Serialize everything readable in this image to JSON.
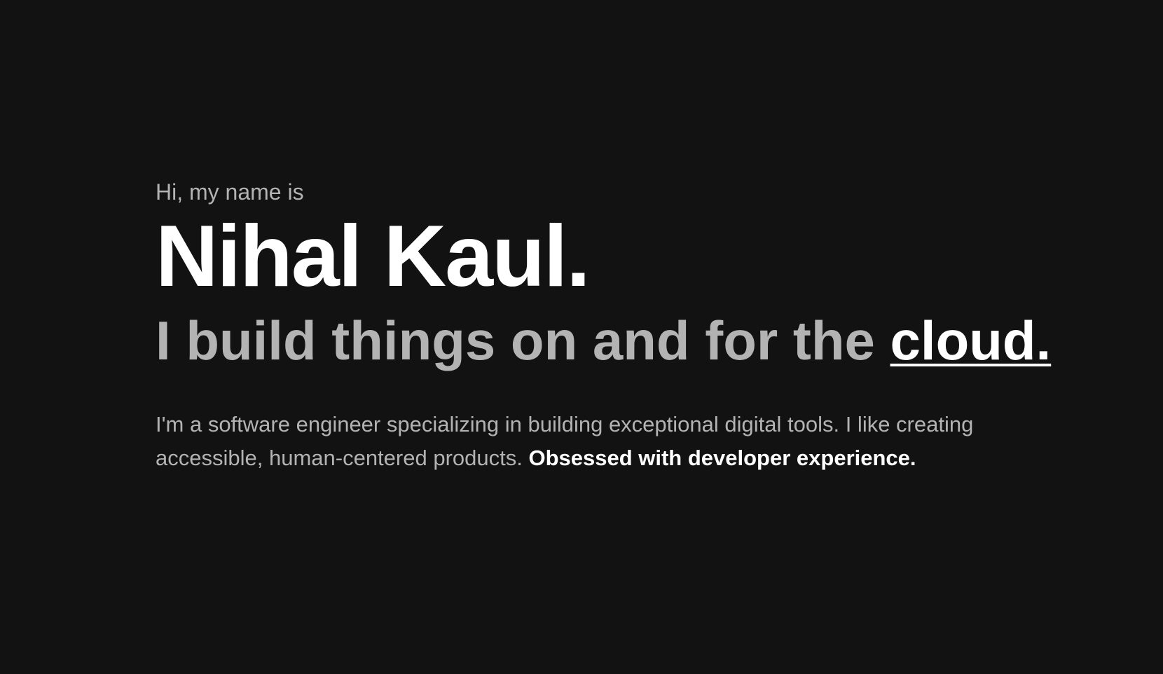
{
  "hero": {
    "greeting": "Hi, my name is",
    "name": "Nihal Kaul.",
    "tagline_prefix": "I build things on and for the ",
    "tagline_link": "cloud.",
    "bio_text": "I'm a software engineer specializing in building exceptional digital tools. I like creating accessible, human-centered products. ",
    "bio_emphasis": "Obsessed with developer experience."
  },
  "colors": {
    "background": "#121212",
    "muted_text": "#b3b3b3",
    "primary_text": "#ffffff"
  }
}
